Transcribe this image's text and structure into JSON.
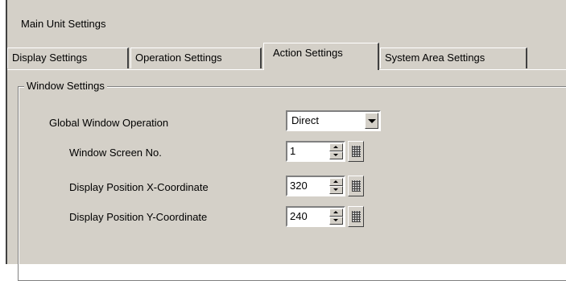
{
  "title": "Main Unit Settings",
  "tabs": [
    {
      "label": "Display Settings",
      "active": false
    },
    {
      "label": "Operation Settings",
      "active": false
    },
    {
      "label": "Action Settings",
      "active": true
    },
    {
      "label": "System Area Settings",
      "active": false
    }
  ],
  "window_settings": {
    "group_label": "Window Settings",
    "global_window_operation": {
      "label": "Global Window Operation",
      "value": "Direct"
    },
    "window_screen_no": {
      "label": "Window Screen No.",
      "value": "1"
    },
    "display_x": {
      "label": "Display Position X-Coordinate",
      "value": "320"
    },
    "display_y": {
      "label": "Display Position Y-Coordinate",
      "value": "240"
    }
  },
  "colors": {
    "face": "#d4d0c8",
    "shadow": "#808080",
    "dark": "#404040",
    "highlight": "#ffffff"
  }
}
